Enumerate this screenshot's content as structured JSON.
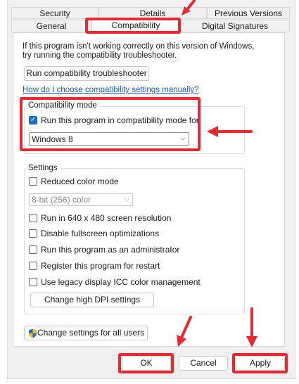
{
  "tabs_top": [
    "Security",
    "Details",
    "Previous Versions"
  ],
  "tabs_bottom": [
    "General",
    "Compatibility",
    "Digital Signatures"
  ],
  "intro": {
    "line1": "If this program isn't working correctly on this version of Windows,",
    "line2": "try running the compatibility troubleshooter."
  },
  "troubleshooter_button": "Run compatibility troubleshooter",
  "help_link": "How do I choose compatibility settings manually?",
  "compat_mode": {
    "legend": "Compatibility mode",
    "checkbox_label": "Run this program in compatibility mode for:",
    "checked": true,
    "selected": "Windows 8"
  },
  "settings": {
    "legend": "Settings",
    "reduced_color": "Reduced color mode",
    "color_select": "8-bit (256) color",
    "res_640": "Run in 640 x 480 screen resolution",
    "disable_fullscreen": "Disable fullscreen optimizations",
    "run_admin": "Run this program as an administrator",
    "register_restart": "Register this program for restart",
    "legacy_icc": "Use legacy display ICC color management",
    "dpi_button": "Change high DPI settings"
  },
  "all_users_button": "Change settings for all users",
  "footer": {
    "ok": "OK",
    "cancel": "Cancel",
    "apply": "Apply"
  },
  "colors": {
    "highlight": "#e12b35",
    "accent": "#1f6ccf",
    "link": "#1a5fb4"
  },
  "icons": {
    "shield": "uac-shield-icon",
    "arrow": "red-arrow-icon"
  }
}
